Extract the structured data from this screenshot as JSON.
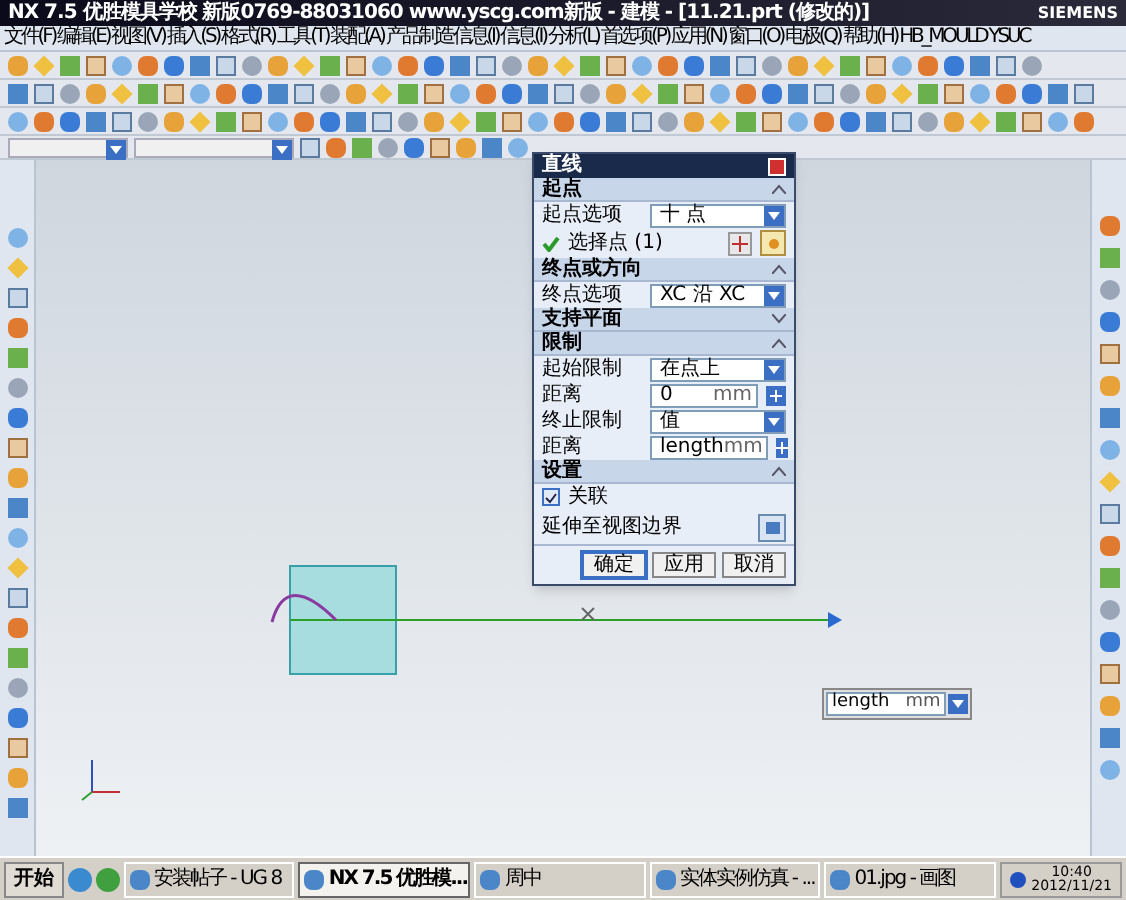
{
  "window": {
    "title": "NX 7.5 优胜模具学校 新版0769-88031060 www.yscg.com新版 - 建模 - [11.21.prt (修改的)]",
    "brand": "SIEMENS"
  },
  "menu": [
    "文件(F)",
    "编辑(E)",
    "视图(V)",
    "插入(S)",
    "格式(R)",
    "工具(T)",
    "装配(A)",
    "产品制造信息(I)",
    "信息(I)",
    "分析(L)",
    "首选项(P)",
    "应用(N)",
    "窗口(O)",
    "电极(Q)",
    "帮助(H)",
    "HB_MOULD",
    "YSUC"
  ],
  "dialog": {
    "title": "直线",
    "sections": [
      {
        "title": "起点",
        "expanded": true,
        "rows": [
          {
            "kind": "select",
            "label": "起点选项",
            "value": "十 点"
          },
          {
            "kind": "selection",
            "label": "选择点 (1)",
            "done": true
          }
        ]
      },
      {
        "title": "终点或方向",
        "expanded": true,
        "rows": [
          {
            "kind": "select",
            "label": "终点选项",
            "value": "XC 沿 XC"
          }
        ]
      },
      {
        "title": "支持平面",
        "expanded": false
      },
      {
        "title": "限制",
        "expanded": true,
        "rows": [
          {
            "kind": "select",
            "label": "起始限制",
            "value": "在点上"
          },
          {
            "kind": "number",
            "label": "距离",
            "value": "0",
            "unit": "mm"
          },
          {
            "kind": "select",
            "label": "终止限制",
            "value": "值"
          },
          {
            "kind": "number",
            "label": "距离",
            "value": "length",
            "unit": "mm"
          }
        ]
      },
      {
        "title": "设置",
        "expanded": true,
        "rows": [
          {
            "kind": "checkbox",
            "label": "关联",
            "checked": true
          },
          {
            "kind": "action",
            "label": "延伸至视图边界"
          }
        ]
      }
    ],
    "buttons": [
      {
        "label": "确定",
        "default": true
      },
      {
        "label": "应用",
        "default": false
      },
      {
        "label": "取消",
        "default": false
      }
    ]
  },
  "canvas": {
    "length_field": {
      "value": "length",
      "unit": "mm"
    }
  },
  "taskbar": {
    "start": "开始",
    "tasks": [
      {
        "label": "安装帖子 - UG 8",
        "selected": false
      },
      {
        "label": "NX 7.5 优胜模...",
        "selected": true
      },
      {
        "label": "周中",
        "selected": false
      },
      {
        "label": "实体实例仿真 - ...",
        "selected": false
      },
      {
        "label": "01.jpg - 画图",
        "selected": false
      }
    ],
    "time": "10:40",
    "date": "2012/11/21"
  }
}
